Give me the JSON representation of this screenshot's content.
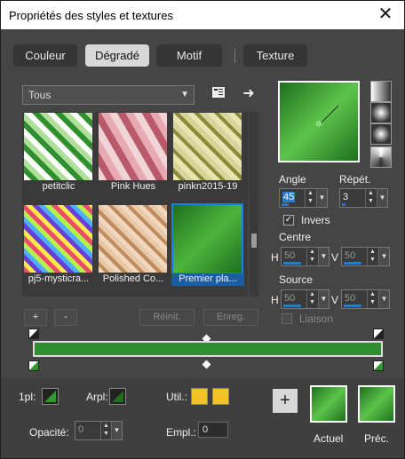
{
  "window": {
    "title": "Propriétés des styles et textures",
    "close_glyph": "✕"
  },
  "tabs": [
    {
      "label": "Couleur"
    },
    {
      "label": "Dégradé"
    },
    {
      "label": "Motif"
    },
    {
      "label": "Texture"
    }
  ],
  "gallery": {
    "category": "Tous",
    "items": [
      {
        "label": "petitclic"
      },
      {
        "label": "Pink Hues"
      },
      {
        "label": "pinkn2015-19"
      },
      {
        "label": "pj5-mysticra..."
      },
      {
        "label": "Polished Co..."
      },
      {
        "label": "Premier pla..."
      }
    ],
    "add_label": "+",
    "remove_label": "-",
    "reset_label": "Réinit.",
    "save_label": "Enreg."
  },
  "properties": {
    "angle_label": "Angle",
    "angle_value": "45",
    "repeat_label": "Répét.",
    "repeat_value": "3",
    "invert_label": "Invers",
    "invert_checked": true,
    "center_label": "Centre",
    "center_h_label": "H",
    "center_h": "50",
    "center_v_label": "V",
    "center_v": "50",
    "source_label": "Source",
    "source_h_label": "H",
    "source_h": "50",
    "source_v_label": "V",
    "source_v": "50",
    "link_label": "Liaison"
  },
  "bottom": {
    "first_label": "1pl:",
    "bg_label": "Arpl:",
    "used_label": "Util.:",
    "opacity_label": "Opacité:",
    "opacity_value": "0",
    "location_label": "Empl.:",
    "location_value": "0",
    "add_label": "+",
    "current_label": "Actuel",
    "previous_label": "Préc."
  },
  "colors": {
    "accent": "#1c7ed6",
    "green_dark": "#1f6f1f",
    "green_light": "#7bd36b",
    "gold": "#f2c229"
  }
}
